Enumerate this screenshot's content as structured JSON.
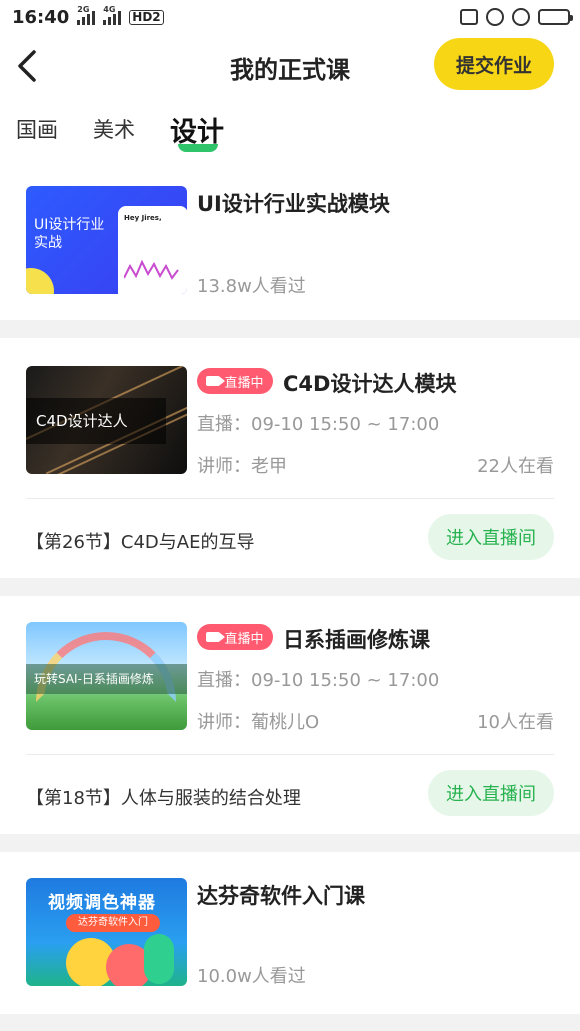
{
  "status_bar": {
    "time": "16:40",
    "signal_1": "2G",
    "signal_2": "4G",
    "hd_badge": "HD2",
    "battery_color": "#3aa0ff"
  },
  "header": {
    "title": "我的正式课",
    "submit_label": "提交作业",
    "back_icon": "chevron-left-icon"
  },
  "tabs": [
    {
      "label": "国画",
      "active": false
    },
    {
      "label": "美术",
      "active": false
    },
    {
      "label": "设计",
      "active": true
    }
  ],
  "courses": [
    {
      "title": "UI设计行业实战模块",
      "views": "13.8w人看过",
      "thumb_text": "UI设计行业实战",
      "thumb_phone_text": "Hey Jires,"
    },
    {
      "live_badge": "直播中",
      "title": "C4D设计达人模块",
      "schedule": "直播：09-10 15:50 ~ 17:00",
      "teacher": "讲师：老甲",
      "watching": "22人在看",
      "lesson": "【第26节】C4D与AE的互导",
      "enter_label": "进入直播间",
      "thumb_text": "C4D设计达人"
    },
    {
      "live_badge": "直播中",
      "title": "日系插画修炼课",
      "schedule": "直播：09-10 15:50 ~ 17:00",
      "teacher": "讲师：葡桃儿O",
      "watching": "10人在看",
      "lesson": "【第18节】人体与服装的结合处理",
      "enter_label": "进入直播间",
      "thumb_text": "玩转SAI-日系插画修炼"
    },
    {
      "title": "达芬奇软件入门课",
      "views": "10.0w人看过",
      "thumb_text": "视频调色神器",
      "thumb_pill": "达芬奇软件入门"
    }
  ],
  "colors": {
    "accent_yellow": "#f7d616",
    "accent_green": "#2fc46a",
    "live_red": "#ff5a6f",
    "enter_bg": "#e6f7ea",
    "enter_text": "#28b24f"
  }
}
